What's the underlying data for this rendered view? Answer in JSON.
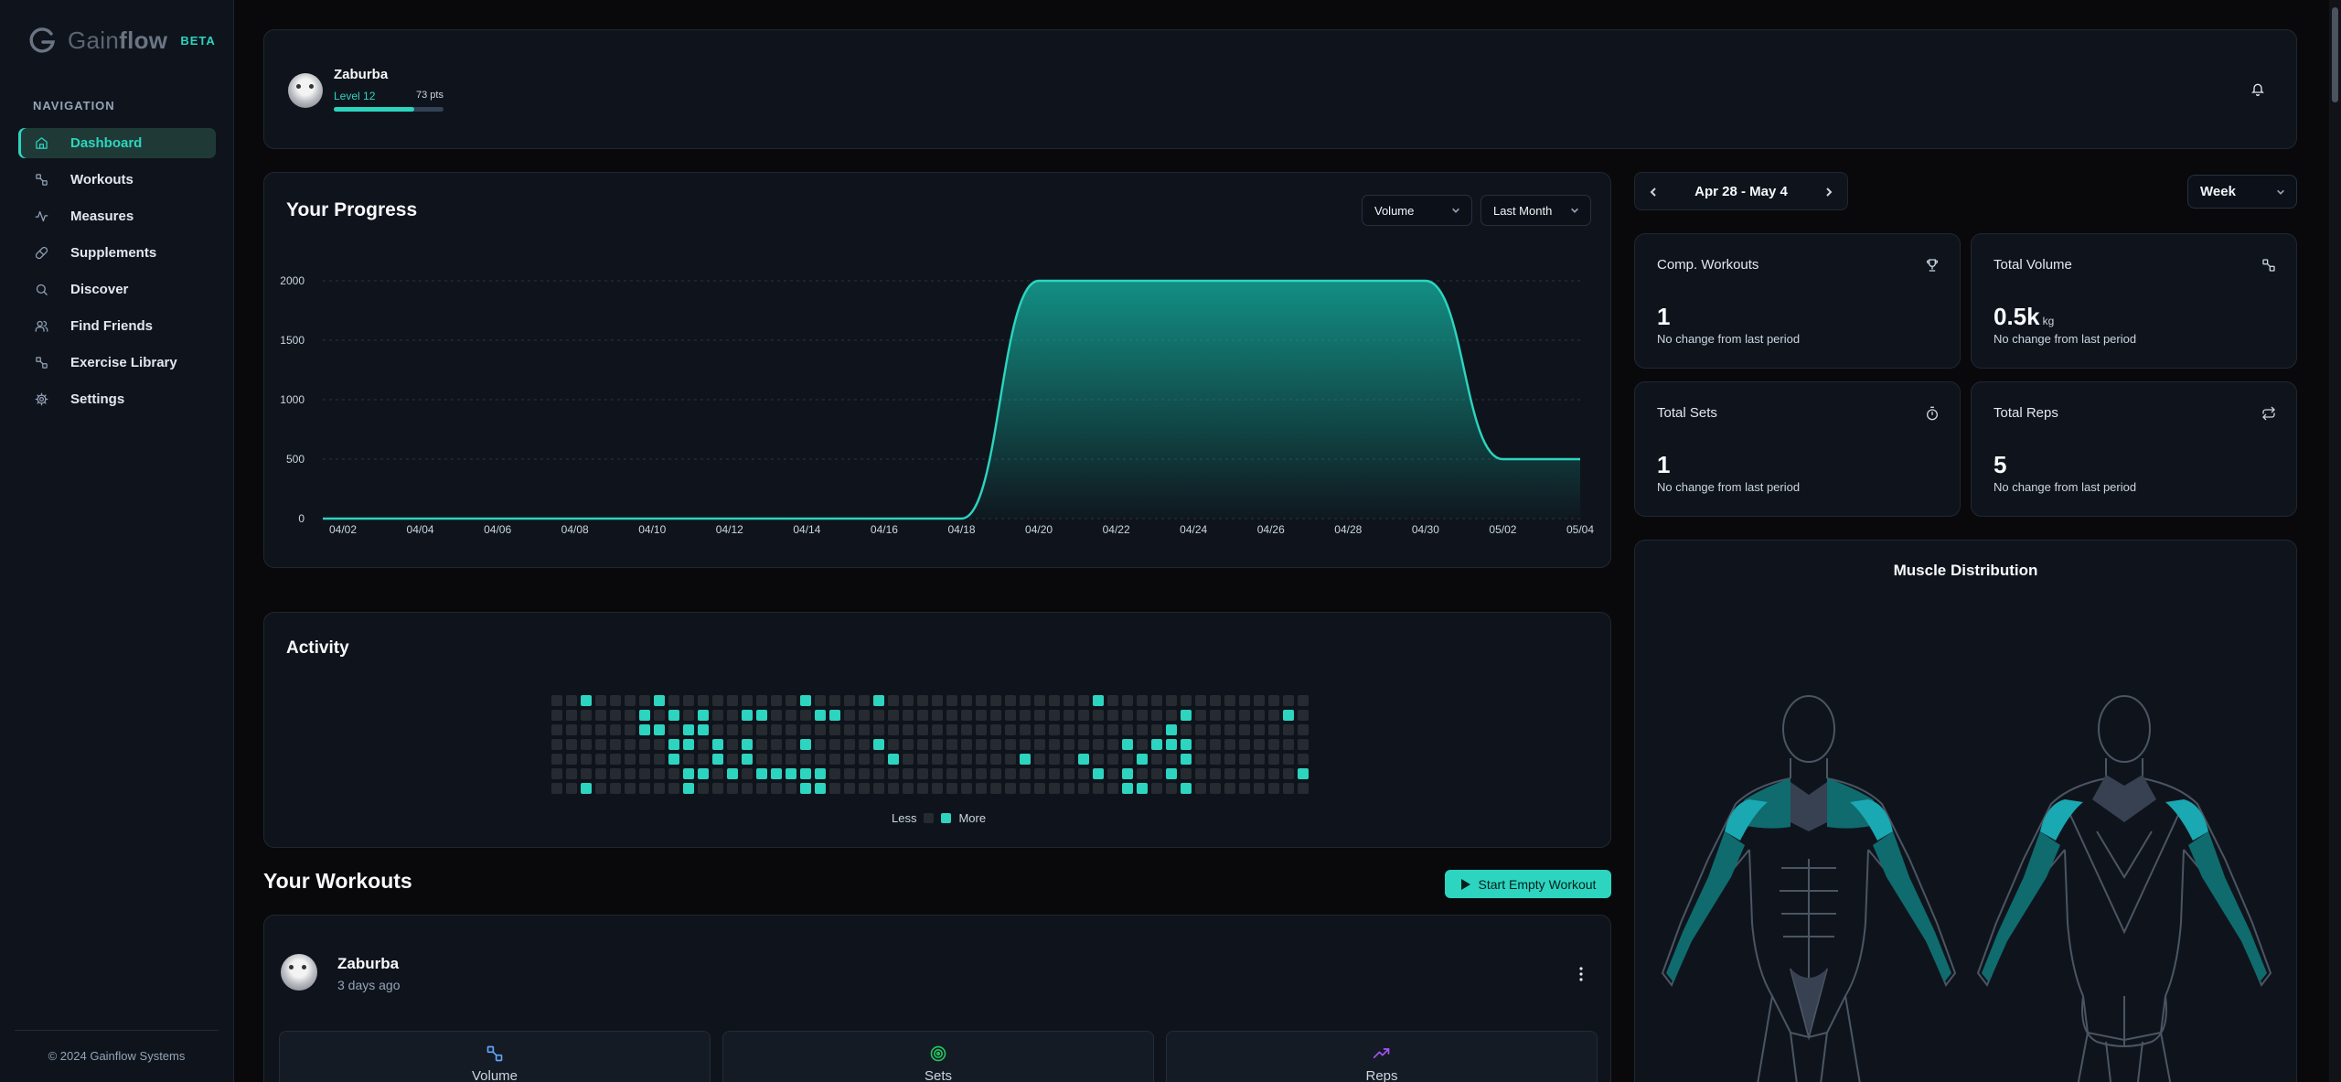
{
  "brand": {
    "name_light": "Gain",
    "name_bold": "flow",
    "badge": "BETA"
  },
  "nav": {
    "heading": "NAVIGATION",
    "items": [
      {
        "label": "Dashboard",
        "icon": "home-icon",
        "active": true
      },
      {
        "label": "Workouts",
        "icon": "dumbbell-icon"
      },
      {
        "label": "Measures",
        "icon": "activity-icon"
      },
      {
        "label": "Supplements",
        "icon": "pill-icon"
      },
      {
        "label": "Discover",
        "icon": "search-icon"
      },
      {
        "label": "Find Friends",
        "icon": "users-icon"
      },
      {
        "label": "Exercise Library",
        "icon": "dumbbell-icon"
      },
      {
        "label": "Settings",
        "icon": "gear-icon"
      }
    ],
    "footer": "© 2024 Gainflow Systems"
  },
  "header": {
    "user_name": "Zaburba",
    "level": "Level 12",
    "points": "73 pts",
    "xp_fraction": 0.73
  },
  "progress": {
    "title": "Your Progress",
    "metric_select": "Volume",
    "range_select": "Last Month"
  },
  "chart_data": {
    "type": "area",
    "x": [
      "04/02",
      "04/04",
      "04/06",
      "04/08",
      "04/10",
      "04/12",
      "04/14",
      "04/16",
      "04/18",
      "04/20",
      "04/22",
      "04/24",
      "04/26",
      "04/28",
      "04/30",
      "05/02",
      "05/04"
    ],
    "y": [
      0,
      0,
      0,
      0,
      0,
      0,
      0,
      0,
      0,
      2000,
      2000,
      2000,
      2000,
      2000,
      2000,
      500,
      500
    ],
    "yticks": [
      0,
      500,
      1000,
      1500,
      2000
    ],
    "ylim": [
      0,
      2000
    ],
    "grid": true,
    "colors": {
      "line": "#2dd4bf",
      "fill": "#14b8a6"
    }
  },
  "activity": {
    "title": "Activity",
    "legend_less": "Less",
    "legend_more": "More",
    "columns": 52,
    "rows": 7,
    "active_cells": [
      [
        2,
        0
      ],
      [
        7,
        0
      ],
      [
        17,
        0
      ],
      [
        22,
        0
      ],
      [
        37,
        0
      ],
      [
        6,
        1
      ],
      [
        8,
        1
      ],
      [
        10,
        1
      ],
      [
        13,
        1
      ],
      [
        14,
        1
      ],
      [
        18,
        1
      ],
      [
        19,
        1
      ],
      [
        43,
        1
      ],
      [
        50,
        1
      ],
      [
        6,
        2
      ],
      [
        7,
        2
      ],
      [
        9,
        2
      ],
      [
        10,
        2
      ],
      [
        42,
        2
      ],
      [
        8,
        3
      ],
      [
        9,
        3
      ],
      [
        11,
        3
      ],
      [
        13,
        3
      ],
      [
        17,
        3
      ],
      [
        22,
        3
      ],
      [
        39,
        3
      ],
      [
        41,
        3
      ],
      [
        42,
        3
      ],
      [
        43,
        3
      ],
      [
        8,
        4
      ],
      [
        11,
        4
      ],
      [
        13,
        4
      ],
      [
        23,
        4
      ],
      [
        32,
        4
      ],
      [
        36,
        4
      ],
      [
        40,
        4
      ],
      [
        43,
        4
      ],
      [
        9,
        5
      ],
      [
        10,
        5
      ],
      [
        12,
        5
      ],
      [
        14,
        5
      ],
      [
        15,
        5
      ],
      [
        16,
        5
      ],
      [
        17,
        5
      ],
      [
        18,
        5
      ],
      [
        37,
        5
      ],
      [
        39,
        5
      ],
      [
        42,
        5
      ],
      [
        51,
        5
      ],
      [
        2,
        6
      ],
      [
        9,
        6
      ],
      [
        17,
        6
      ],
      [
        18,
        6
      ],
      [
        39,
        6
      ],
      [
        40,
        6
      ],
      [
        43,
        6
      ]
    ],
    "colors": {
      "active": "#2dd4bf",
      "empty": "#262a31"
    }
  },
  "workouts": {
    "title": "Your Workouts",
    "start_label": "Start Empty Workout",
    "item": {
      "user": "Zaburba",
      "time_ago": "3 days ago"
    },
    "stats": [
      {
        "label": "Volume",
        "icon": "dumbbell-icon",
        "color": "#60a5fa"
      },
      {
        "label": "Sets",
        "icon": "target-icon",
        "color": "#22c55e"
      },
      {
        "label": "Reps",
        "icon": "trending-up-icon",
        "color": "#a855f7"
      }
    ]
  },
  "period": {
    "range": "Apr 28 - May 4",
    "granularity": "Week"
  },
  "stats": [
    {
      "label": "Comp. Workouts",
      "value": "1",
      "unit": "",
      "change": "No change from last period",
      "icon": "trophy-icon"
    },
    {
      "label": "Total Volume",
      "value": "0.5k",
      "unit": "kg",
      "change": "No change from last period",
      "icon": "dumbbell-icon"
    },
    {
      "label": "Total Sets",
      "value": "1",
      "unit": "",
      "change": "No change from last period",
      "icon": "timer-icon"
    },
    {
      "label": "Total Reps",
      "value": "5",
      "unit": "",
      "change": "No change from last period",
      "icon": "repeat-icon"
    }
  ],
  "muscle": {
    "title": "Muscle Distribution",
    "colors": {
      "worked": "#0f6b6e",
      "highlight": "#1aa8b2",
      "body": "#4b5563"
    }
  }
}
